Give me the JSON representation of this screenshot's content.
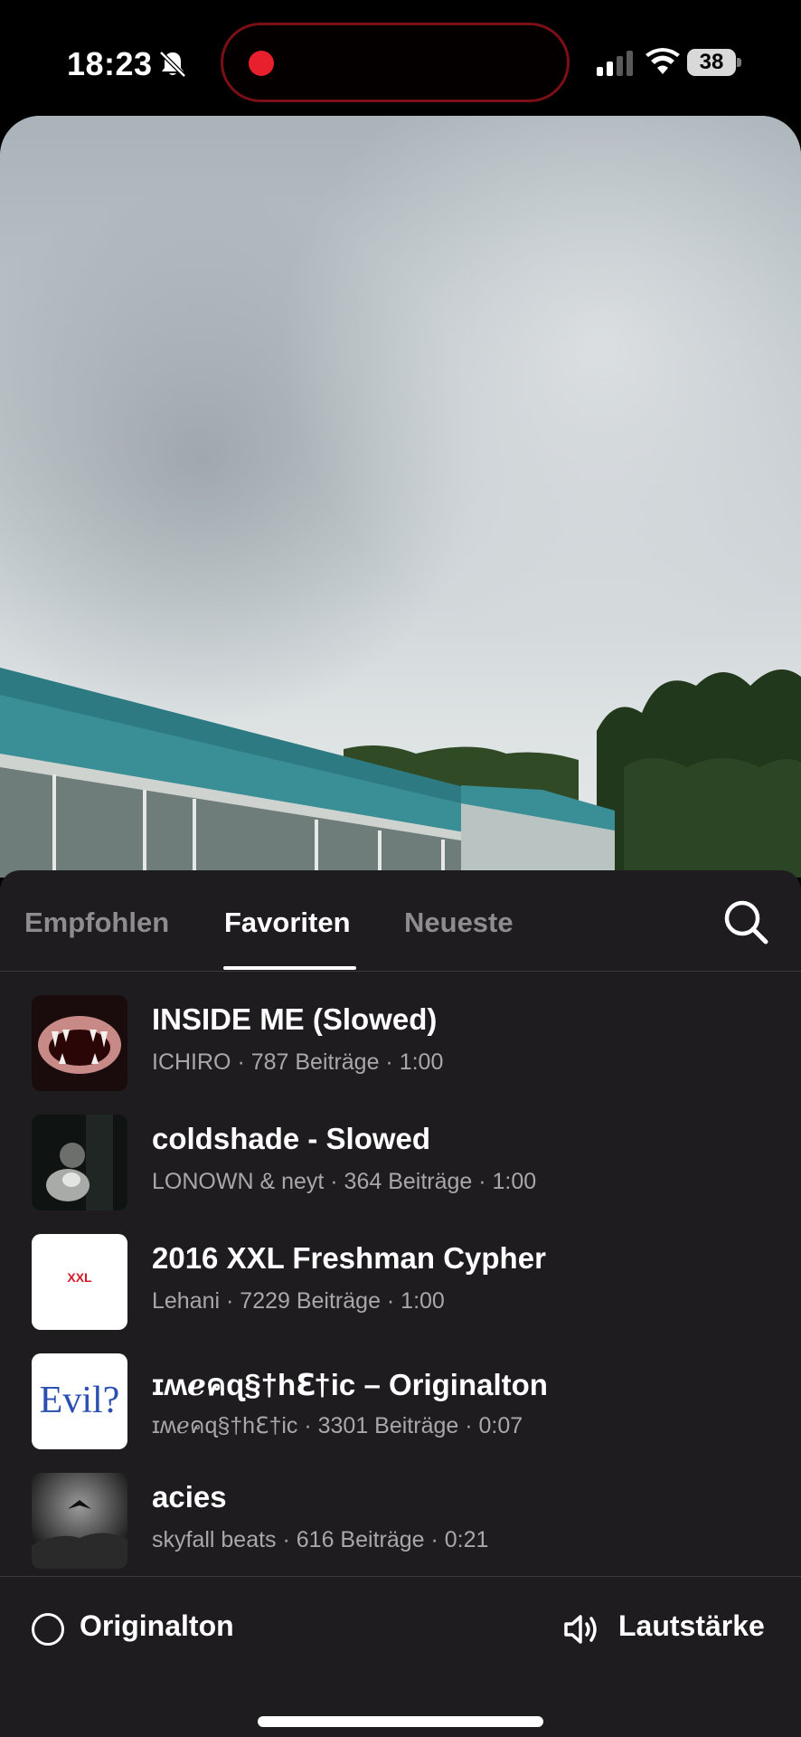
{
  "status_bar": {
    "time": "18:23",
    "battery": "38",
    "icons": [
      "bell-slash-icon",
      "recording-dot-icon",
      "cellular-signal-icon",
      "wifi-icon",
      "battery-icon"
    ]
  },
  "tabs": [
    {
      "label": "Empfohlen",
      "active": false
    },
    {
      "label": "Favoriten",
      "active": true
    },
    {
      "label": "Neueste",
      "active": false
    }
  ],
  "songs": [
    {
      "title": "INSIDE ME (Slowed)",
      "meta": "ICHIRO · 787 Beiträge · 1:00"
    },
    {
      "title": "coldshade - Slowed",
      "meta": "LONOWN & neyt · 364 Beiträge · 1:00"
    },
    {
      "title": "2016 XXL Freshman Cypher",
      "meta": "Lehani · 7229 Beiträge · 1:00",
      "thumb_text": "XXL"
    },
    {
      "title": "ɪʍℯคɋ§†hℇ†ic – Originalton",
      "meta": "ɪʍℯคɋ§†hℇ†ic · 3301 Beiträge · 0:07",
      "thumb_text": "Evil?"
    },
    {
      "title": "acies",
      "meta": "skyfall beats · 616 Beiträge · 0:21"
    }
  ],
  "bottom_bar": {
    "original_label": "Originalton",
    "volume_label": "Lautstärke"
  },
  "colors": {
    "sheet_bg": "#1e1c1e",
    "recording_red": "#e8202e",
    "meta_text": "#a9a7aa"
  }
}
